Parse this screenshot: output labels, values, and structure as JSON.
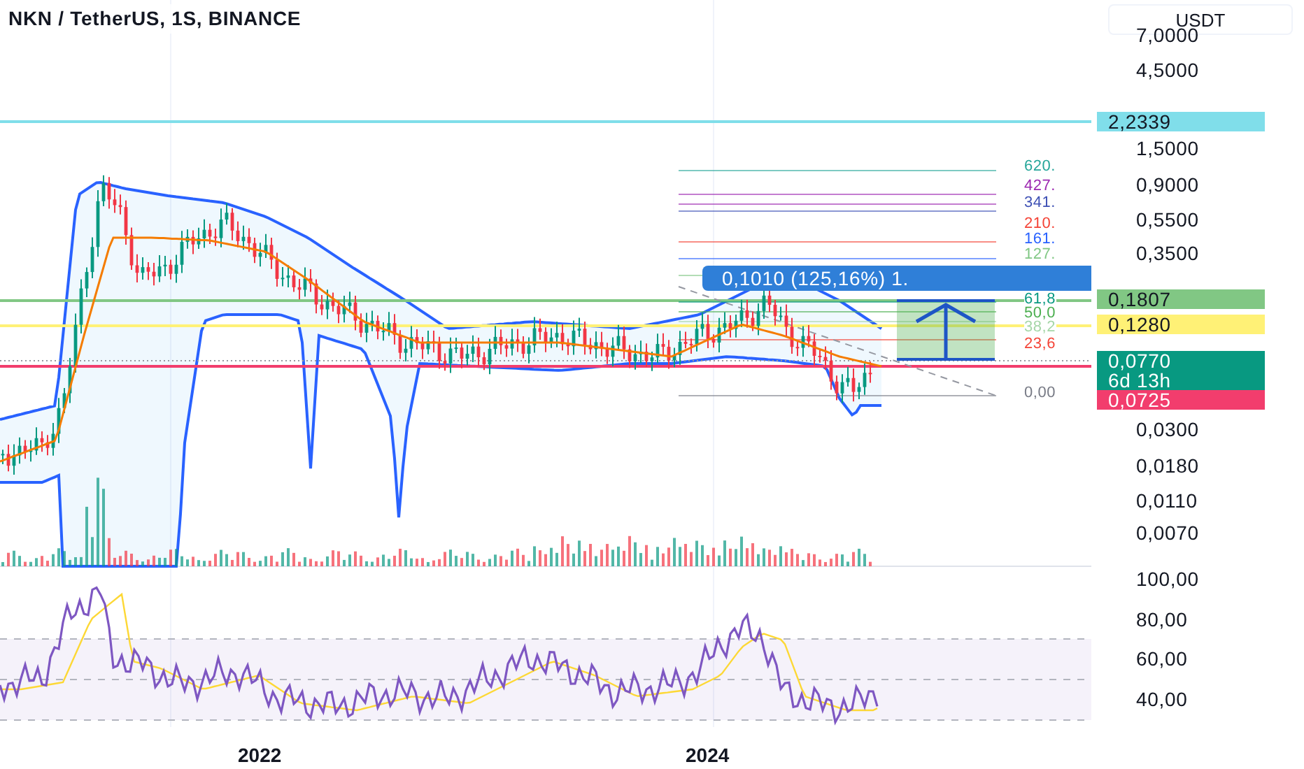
{
  "title": "NKN / TetherUS, 1S, BINANCE",
  "currency": "USDT",
  "price_ticks": [
    "7,0000",
    "4,5000",
    "1,5000",
    "0,9000",
    "0,5500",
    "0,3500",
    "0,0300",
    "0,0180",
    "0,0110",
    "0,0070"
  ],
  "price_badges": [
    {
      "text": "2,2339",
      "color": "#80deea"
    },
    {
      "text": "0,1807",
      "color": "#81c784"
    },
    {
      "text": "0,1280",
      "color": "#fff176"
    },
    {
      "text": "0,0770",
      "subtext": "6d 13h",
      "color": "#089981"
    },
    {
      "text": "0,0725",
      "color": "#f23d6d"
    }
  ],
  "fib_labels": [
    {
      "text": "620.",
      "color": "#26a69a"
    },
    {
      "text": "427.",
      "color": "#9c27b0"
    },
    {
      "text": "341.",
      "color": "#3f51b5"
    },
    {
      "text": "210.",
      "color": "#f44336"
    },
    {
      "text": "161.",
      "color": "#2962ff"
    },
    {
      "text": "127.",
      "color": "#81c784"
    },
    {
      "text": "61,8",
      "color": "#089981"
    },
    {
      "text": "50,0",
      "color": "#4caf50"
    },
    {
      "text": "38,2",
      "color": "#a5d6a7"
    },
    {
      "text": "23,6",
      "color": "#f44336"
    },
    {
      "text": "0,00",
      "color": "#787b86"
    }
  ],
  "measure_label": "0,1010 (125,16%) 1.",
  "rsi_ticks": [
    "100,00",
    "80,00",
    "60,00",
    "40,00"
  ],
  "time_ticks": [
    "2022",
    "2024"
  ]
}
